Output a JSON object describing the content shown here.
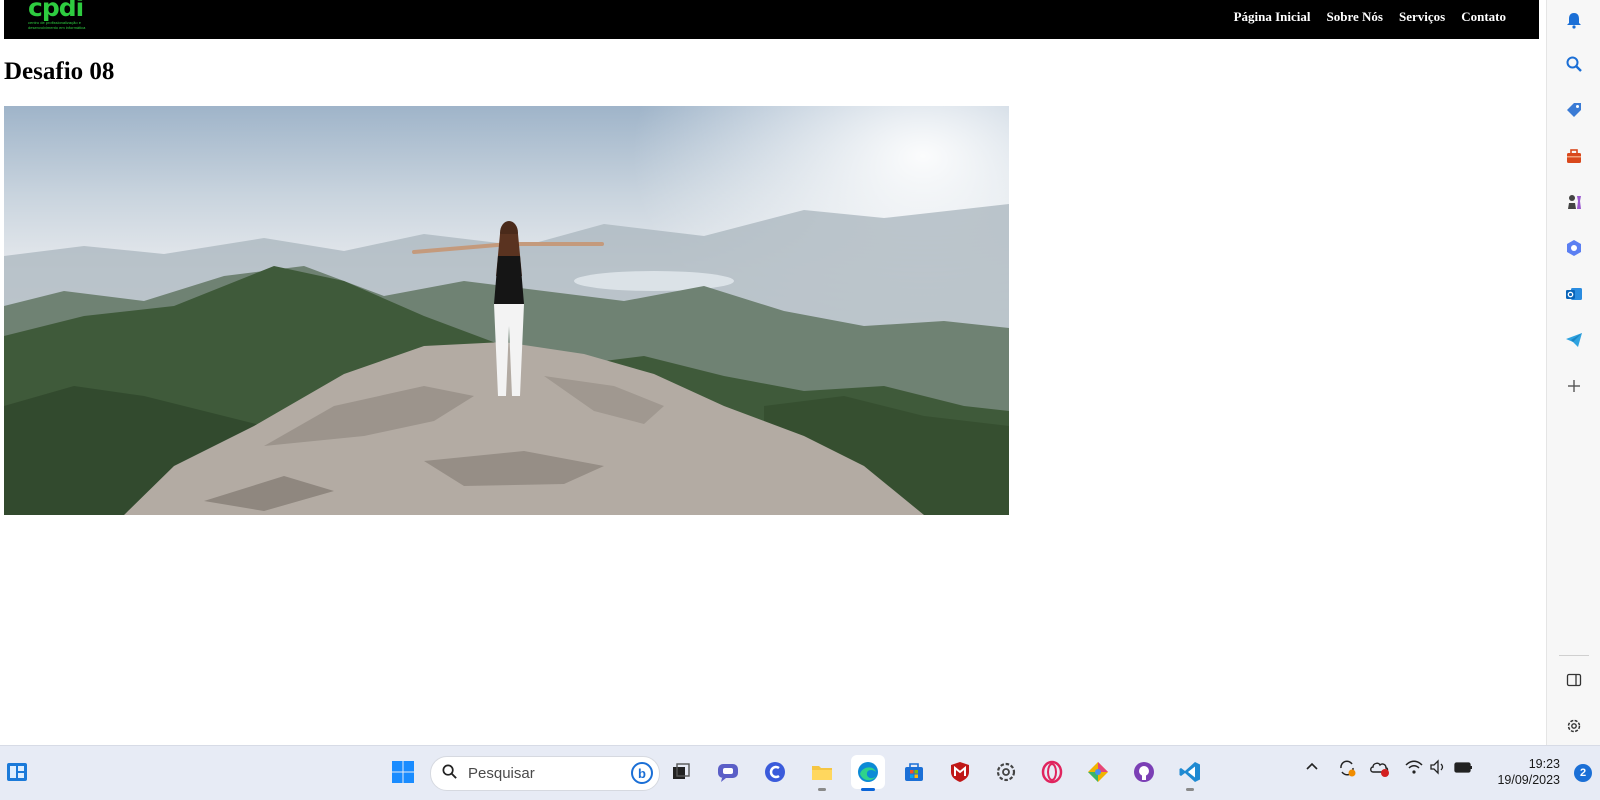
{
  "site": {
    "logo_text": "cpdi",
    "logo_tagline": "centro de profissionalização e desenvolvimento em informática",
    "nav": [
      "Página Inicial",
      "Sobre Nós",
      "Serviços",
      "Contato"
    ],
    "page_title": "Desafio 08"
  },
  "edge_sidebar": {
    "icons": [
      "bell-icon",
      "search-icon",
      "tag-icon",
      "toolbox-icon",
      "chess-icon",
      "copilot-icon",
      "outlook-icon",
      "telegram-icon",
      "plus-icon",
      "sidebar-toggle-icon",
      "gear-icon"
    ]
  },
  "taskbar": {
    "search_placeholder": "Pesquisar",
    "time": "19:23",
    "date": "19/09/2023",
    "notification_count": "2"
  },
  "colors": {
    "header_bg": "#000000",
    "logo_green": "#2ecc40",
    "accent_blue": "#0a64d8"
  }
}
